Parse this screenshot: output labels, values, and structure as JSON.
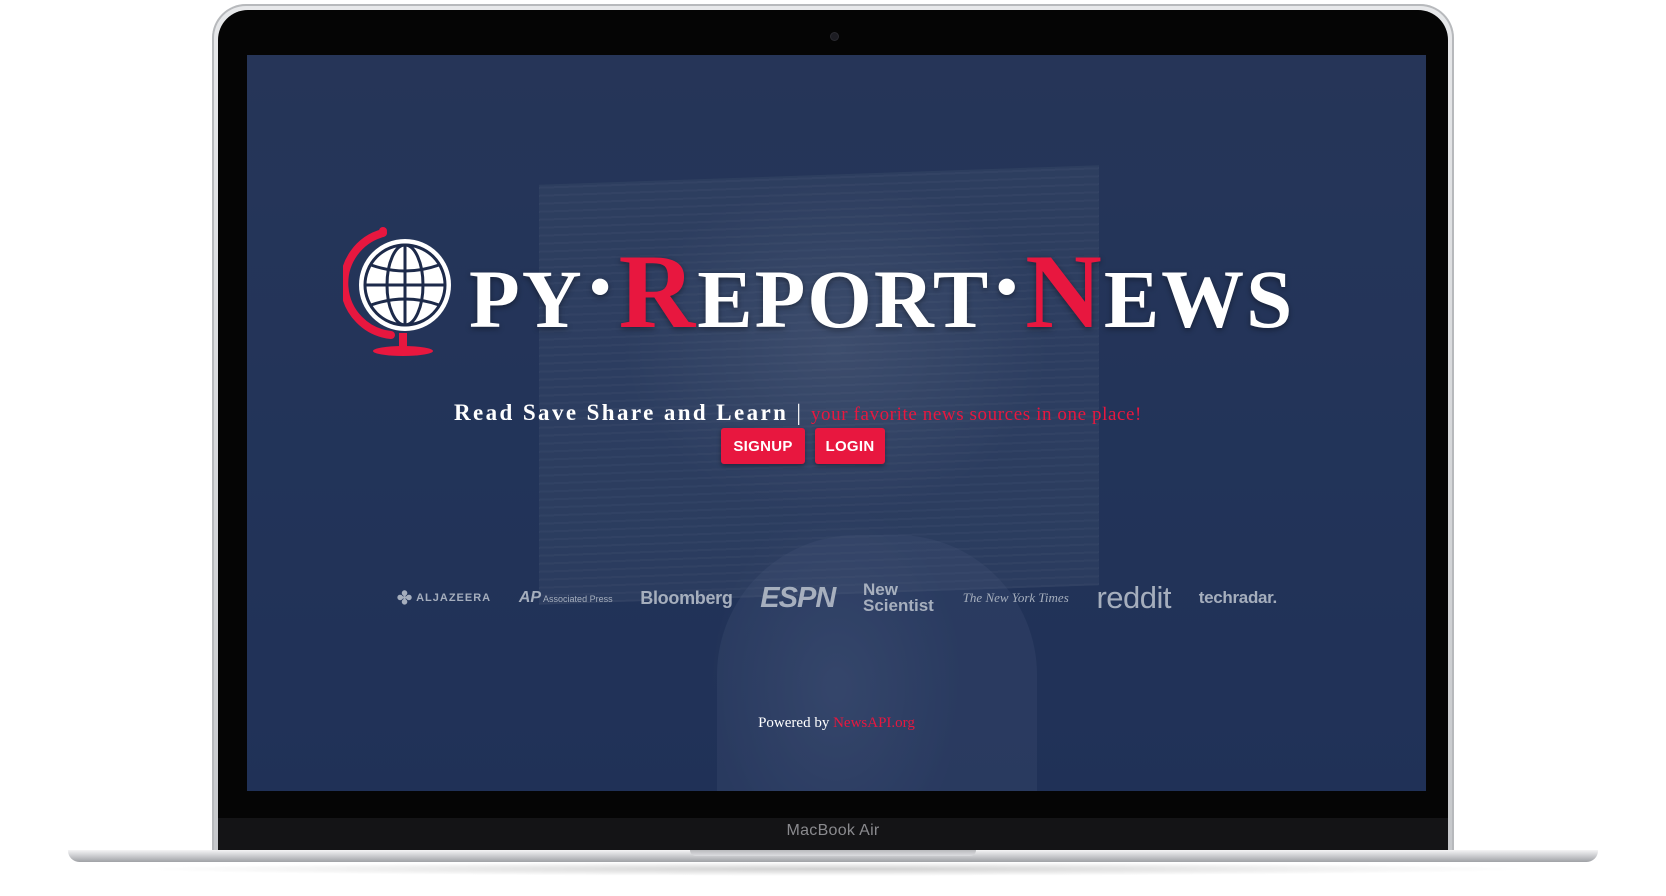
{
  "device": {
    "model_label": "MacBook Air"
  },
  "logo": {
    "name_parts": [
      {
        "text": "PY",
        "style": "white"
      },
      {
        "text": "•",
        "style": "dot"
      },
      {
        "text": "R",
        "style": "red-big"
      },
      {
        "text": "EPORT",
        "style": "white"
      },
      {
        "text": "•",
        "style": "dot"
      },
      {
        "text": "N",
        "style": "red-big"
      },
      {
        "text": "EWS",
        "style": "white"
      }
    ],
    "icon": "globe-icon"
  },
  "tagline": {
    "main": "Read Save Share and Learn",
    "separator": "|",
    "sub": "your favorite news sources in one place!"
  },
  "buttons": {
    "signup": "SIGNUP",
    "login": "LOGIN"
  },
  "sources": [
    {
      "id": "aljazeera",
      "label": "ALJAZEERA"
    },
    {
      "id": "ap",
      "prefix": "AP",
      "label": "Associated Press"
    },
    {
      "id": "bloomberg",
      "label": "Bloomberg"
    },
    {
      "id": "espn",
      "label": "ESPN"
    },
    {
      "id": "newscientist",
      "label": "New Scientist"
    },
    {
      "id": "nyt",
      "label": "The New York Times"
    },
    {
      "id": "reddit",
      "label": "reddit"
    },
    {
      "id": "techradar",
      "label": "techradar."
    }
  ],
  "footer": {
    "powered_by": "Powered by",
    "link": "NewsAPI.org"
  },
  "colors": {
    "accent": "#e8173f",
    "overlay": "#203055",
    "text": "#ffffff",
    "logo_muted": "#b4bcc8"
  }
}
